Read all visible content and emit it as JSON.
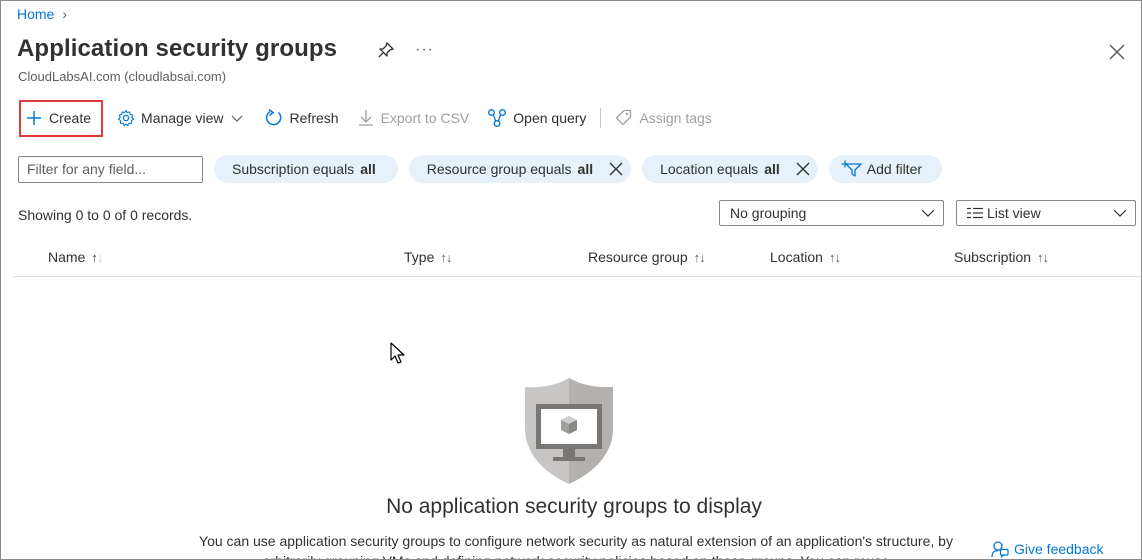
{
  "breadcrumb": {
    "home": "Home"
  },
  "header": {
    "title": "Application security groups",
    "subtitle": "CloudLabsAI.com (cloudlabsai.com)",
    "more": "···"
  },
  "toolbar": {
    "create": "Create",
    "manage_view": "Manage view",
    "refresh": "Refresh",
    "export_csv": "Export to CSV",
    "open_query": "Open query",
    "assign_tags": "Assign tags"
  },
  "filters": {
    "placeholder": "Filter for any field...",
    "subscription": {
      "prefix": "Subscription equals",
      "value": "all"
    },
    "resource_group": {
      "prefix": "Resource group equals",
      "value": "all"
    },
    "location": {
      "prefix": "Location equals",
      "value": "all"
    },
    "add_filter": "Add filter"
  },
  "records": "Showing 0 to 0 of 0 records.",
  "grouping": {
    "selected": "No grouping"
  },
  "view": {
    "selected": "List view"
  },
  "columns": [
    "Name",
    "Type",
    "Resource group",
    "Location",
    "Subscription"
  ],
  "sort_glyph": "↑↓",
  "empty": {
    "title": "No application security groups to display",
    "description": "You can use application security groups to configure network security as natural extension of an application's structure, by arbitrarily grouping VMs and defining network security policies based on those groups. You can reuse"
  },
  "feedback": "Give feedback",
  "colors": {
    "accent": "#0078d4",
    "pill_bg": "#e6f1fb",
    "highlight": "#e03a3e",
    "shield": "#c8c6c4"
  }
}
